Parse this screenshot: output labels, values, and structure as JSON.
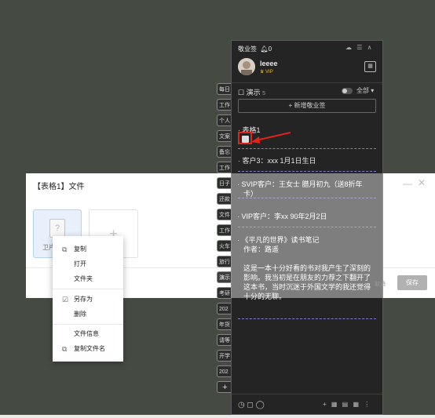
{
  "dialog": {
    "title": "【表格1】文件",
    "file_label": "卫片",
    "add_glyph": "+",
    "min_glyph": "—",
    "close_glyph": "✕",
    "cancel": "取消",
    "save": "保存"
  },
  "side_tabs": [
    "每日",
    "工作",
    "个人",
    "文案",
    "备忘",
    "工作",
    "日子",
    "还款",
    "文件",
    "工作",
    "火车",
    "旅行",
    "演示",
    "考研",
    "202",
    "年货",
    "请等",
    "开学",
    "202",
    "+"
  ],
  "panel": {
    "header_title": "敬业签",
    "header_count": "0",
    "header_icons": "☁ ☰ ∧",
    "username": "leeee",
    "vip": "VIP",
    "group_name": "演示",
    "group_count": "5",
    "all_label": "全部",
    "new_button": "+ 新增敬业签",
    "notes": {
      "n1": "表格1",
      "n2": "客户3：xxx 1月1日生日",
      "n3_line1": "SVIP客户：王女士 腊月初九（送8折年",
      "n3_line2": "卡）",
      "n4": "VIP客户：李xx 90年2月2日",
      "n5_line1": "《平凡的世界》读书笔记",
      "n5_line2": "作者：路遥",
      "n5_body1": "这是一本十分好看的书对我产生了深刻的",
      "n5_body2": "影响。我当初是在朋友的力荐之下翻开了",
      "n5_body3": "这本书，当时沉迷于外国文学的我还觉得",
      "n5_body4": "十分的无聊。"
    },
    "bottom_left": "◷ ◻ ◯",
    "bottom_right": "+ ▦ ▤ ▦ ⋮"
  },
  "context_menu": {
    "copy": "复制",
    "open": "打开",
    "folder": "文件夹",
    "save_as": "另存为",
    "delete": "删除",
    "file_info": "文件信息",
    "copy_filename": "复制文件名"
  },
  "colors": {
    "accent_red": "#e0231c",
    "panel_bg": "#232423",
    "dash": "#7d7dcf",
    "vip_gold": "#e6b83a"
  },
  "icons": [
    "bell-icon",
    "cloud-icon",
    "menu-icon",
    "chevron-up-icon",
    "calendar-icon",
    "note-icon",
    "copy-icon",
    "save-as-icon",
    "clock-icon",
    "search-icon"
  ]
}
